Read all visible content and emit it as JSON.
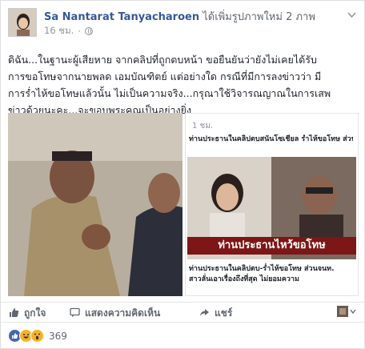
{
  "post": {
    "author": "Sa Nantarat Tanyacharoen",
    "action": " ได้เพิ่มรูปภาพใหม่ 2 ภาพ",
    "time": "16 ชม.",
    "text_lines": [
      "ดิฉัน...ในฐานะผู้เสียหาย จากคลิปที่ถูกตบหน้า ขอยืนยันว่ายังไม่เคยได้รับ",
      "การขอโทษจากนายพลด เอมบัณฑิตย์ แต่อย่างใด กรณีที่มีการลงข่าวว่า มี",
      "การร่ำไห้ขอโทษแล้วนั้น ไม่เป็นความจริง...กรุณาใช้วิจารณญาณในการเสพ",
      "ข่าวด้วยนะคะ...จะขอบพระคุณเป็นอย่างยิ่ง"
    ]
  },
  "shared_image": {
    "header_time": "1 ชม.",
    "caption_top": "ท่านประธานในคลิปตบสนั่นโซเชี่ยล ร่ำไห้ขอโทษ ส่วนจนท.สาวลั่นเอาเรื่องถึงที่สุด ไม่ยอมความ",
    "banner": "ท่านประธานไหว้ขอโทษ",
    "caption_bottom_lines": [
      "ท่านประธานในคลิปตบ-ร่ำไห้ขอโทษ ส่วนจนท.",
      "สาวลั่นเอาเรื่องถึงที่สุด ไม่ยอมความ"
    ]
  },
  "actions": {
    "like": "ถูกใจ",
    "comment": "แสดงความคิดเห็น",
    "share": "แชร์"
  },
  "reactions": {
    "count": "369",
    "colors": {
      "like": "#4267b2",
      "haha": "#f7b125",
      "wow": "#f7b125"
    }
  }
}
